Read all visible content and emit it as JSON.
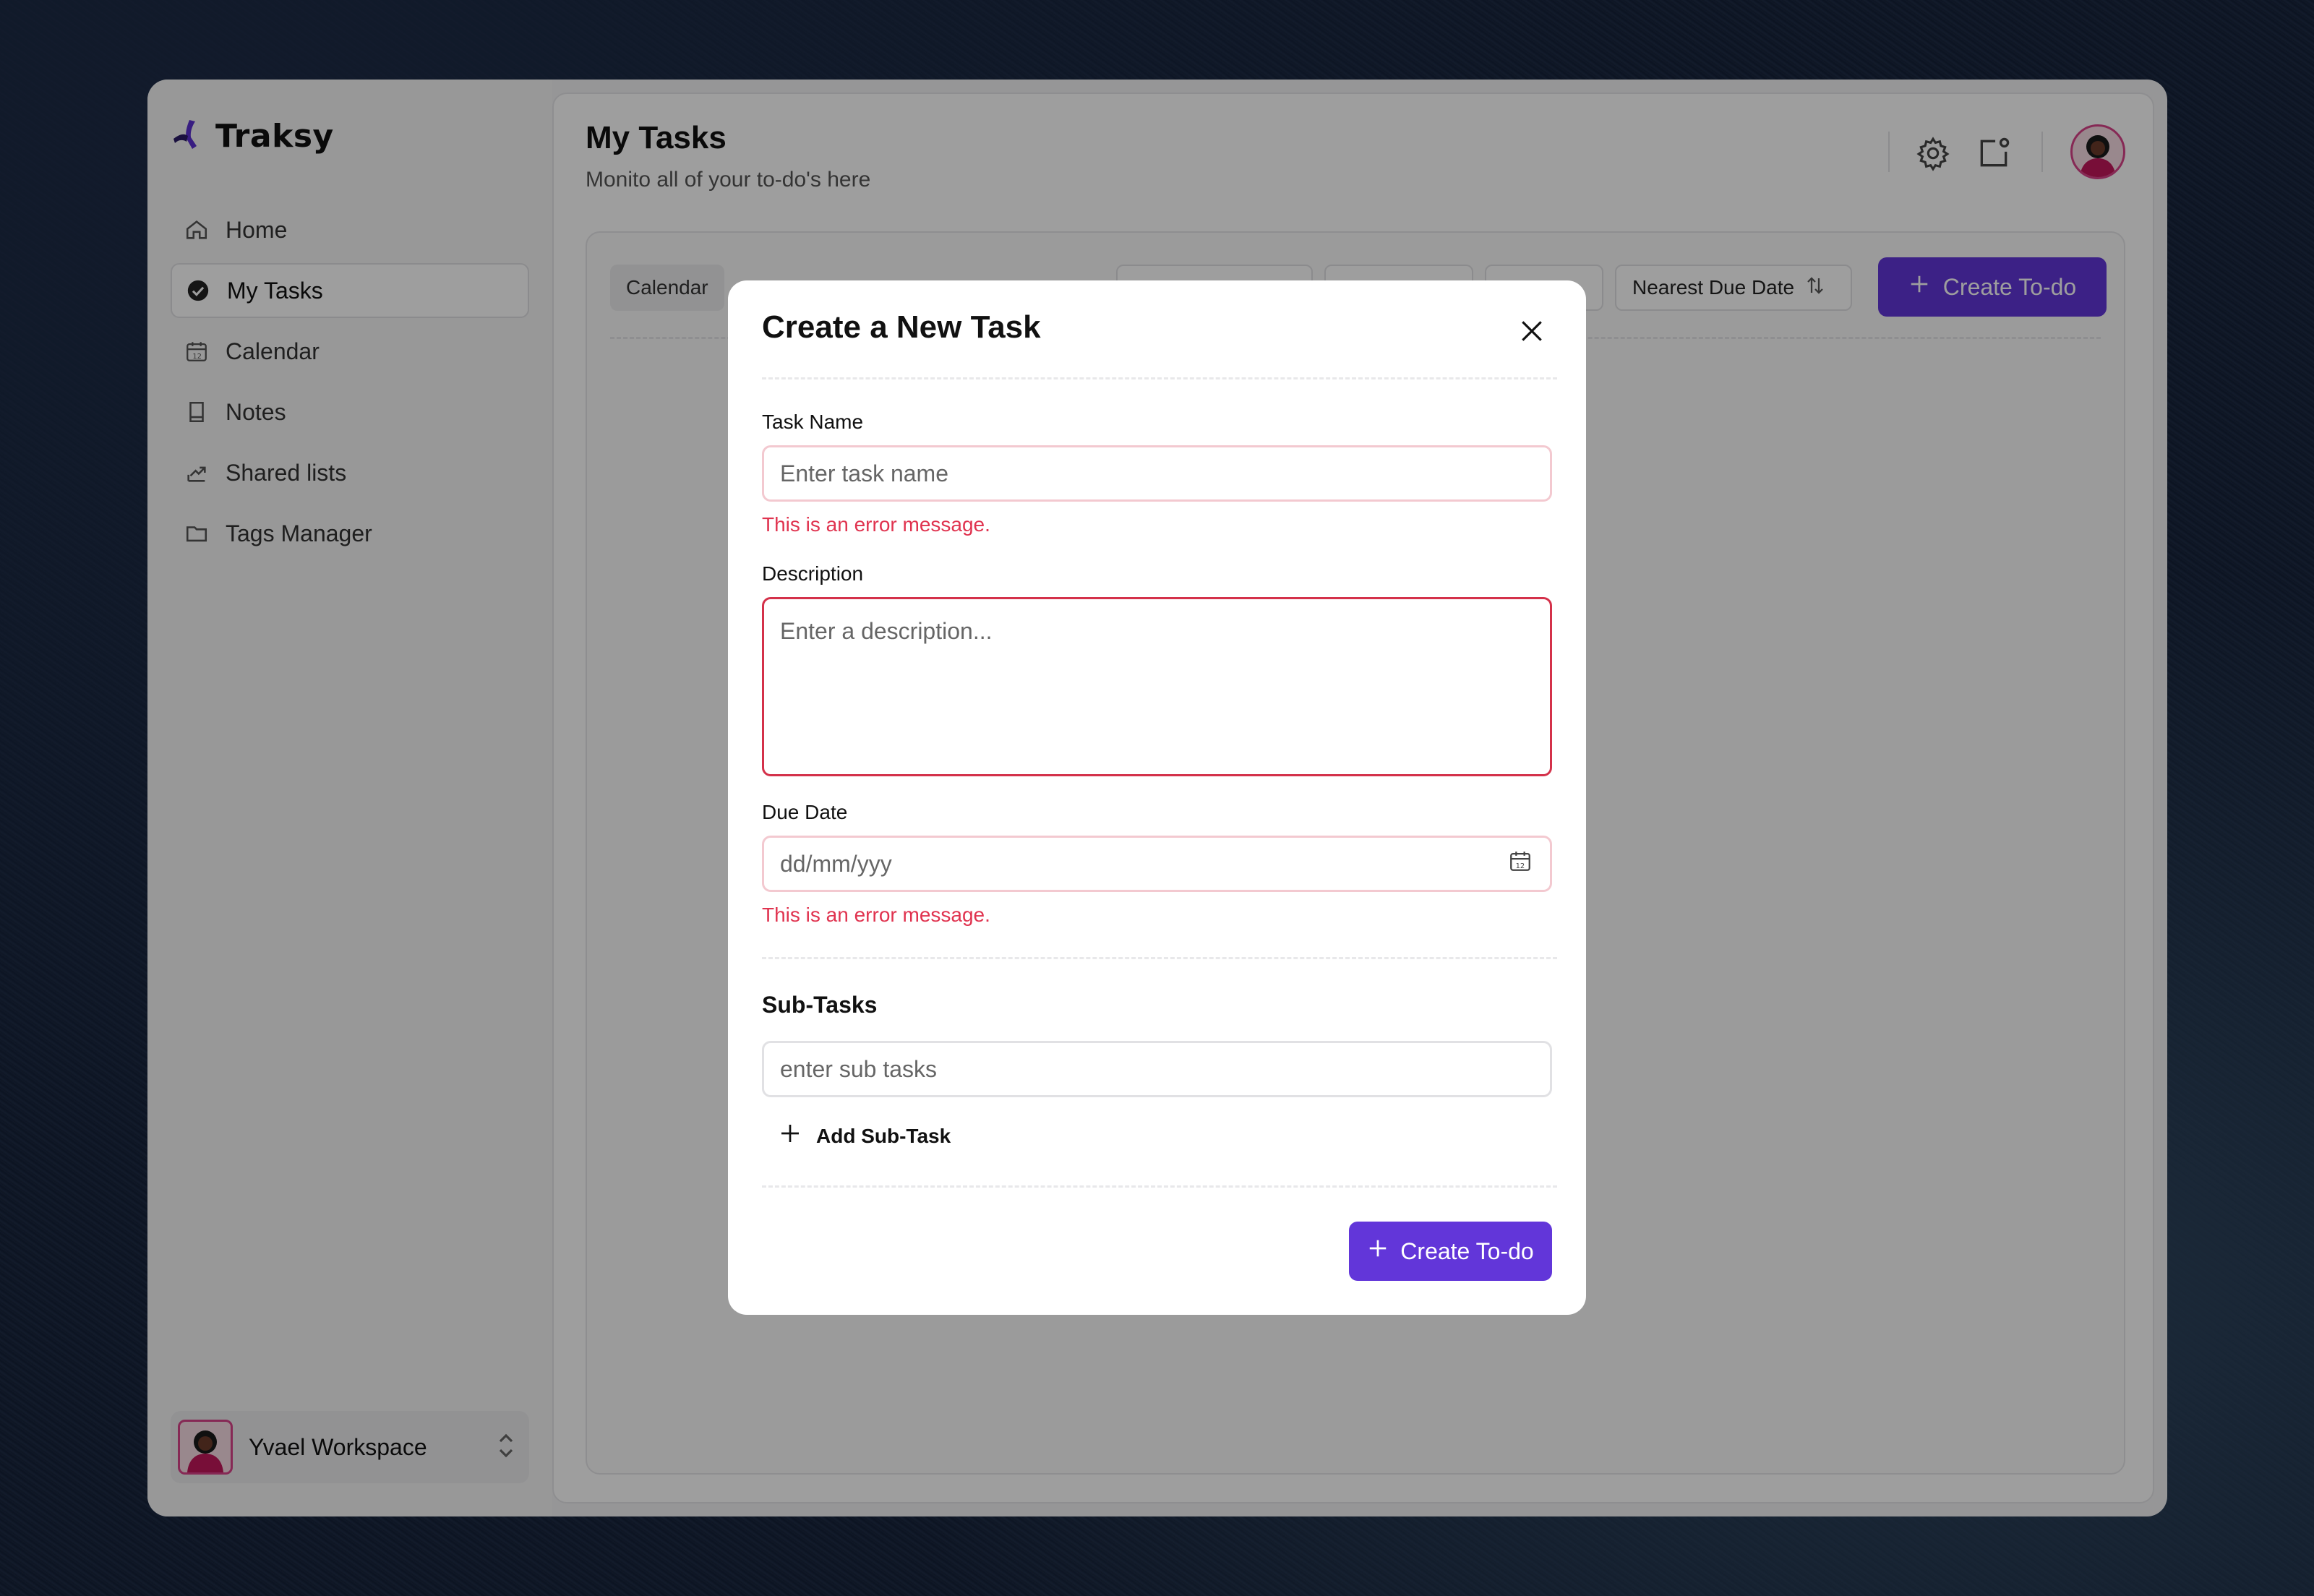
{
  "app": {
    "name": "Traksy"
  },
  "sidebar": {
    "items": [
      {
        "label": "Home",
        "icon": "home-icon"
      },
      {
        "label": "My Tasks",
        "icon": "check-circle-icon",
        "active": true
      },
      {
        "label": "Calendar",
        "icon": "calendar-icon"
      },
      {
        "label": "Notes",
        "icon": "notebook-icon"
      },
      {
        "label": "Shared lists",
        "icon": "share-icon"
      },
      {
        "label": "Tags Manager",
        "icon": "folder-icon"
      }
    ],
    "workspace": {
      "name": "Yvael Workspace"
    }
  },
  "header": {
    "title": "My Tasks",
    "subtitle": "Monito all of your to-do's here"
  },
  "toolbar": {
    "view_tab": "Calendar",
    "sort_label": "Nearest Due Date",
    "create_label": "Create To-do"
  },
  "modal": {
    "title": "Create a New Task",
    "task_name": {
      "label": "Task Name",
      "placeholder": "Enter task name",
      "error": "This is an error message."
    },
    "description": {
      "label": "Description",
      "placeholder": "Enter a description..."
    },
    "due_date": {
      "label": "Due Date",
      "placeholder": "dd/mm/yyy",
      "error": "This is an error message."
    },
    "subtasks": {
      "heading": "Sub-Tasks",
      "placeholder": "enter sub tasks",
      "add_label": "Add Sub-Task"
    },
    "submit_label": "Create To-do"
  },
  "colors": {
    "accent": "#6236d9",
    "error": "#e0334f",
    "avatar_ring": "#d9438a"
  }
}
